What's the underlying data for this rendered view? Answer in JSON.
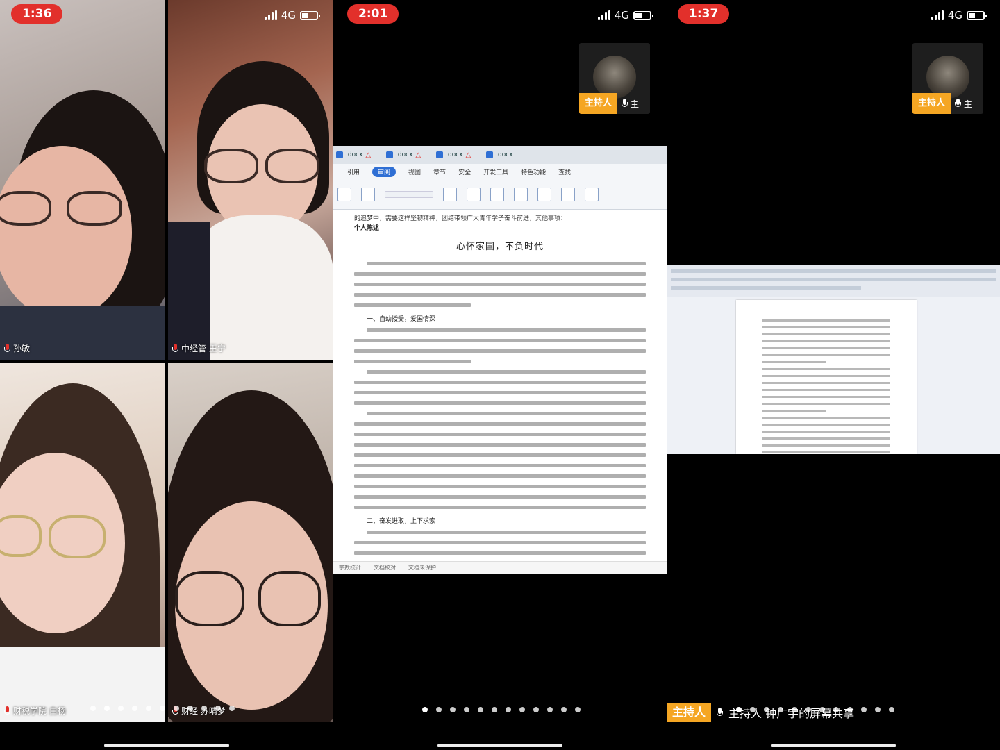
{
  "panel1": {
    "time": "1:36",
    "network": "4G",
    "tiles": [
      {
        "name": "孙敏"
      },
      {
        "name": "中经管 王宁"
      },
      {
        "name": "财税学院 白杨"
      },
      {
        "name": "财经 苏晴梦"
      }
    ],
    "page_dots": 11,
    "active_dot": 1
  },
  "panel2": {
    "time": "2:01",
    "network": "4G",
    "host": {
      "badge": "主持人",
      "mic_label": "主"
    },
    "doc": {
      "tabs": [
        ".docx",
        ".docx",
        ".docx",
        ".docx"
      ],
      "menu": [
        "引用",
        "审阅",
        "视图",
        "章节",
        "安全",
        "开发工具",
        "特色功能",
        "查找"
      ],
      "menu_selected": "审阅",
      "pre_line": "的追梦中，需要这样坚韧精神，团结带领广大青年学子奋斗前进，其他事项：",
      "section_label": "个人陈述",
      "title": "心怀家国，不负时代",
      "heading1": "一、自幼授受，爱国情深",
      "heading2": "二、奋发进取，上下求索",
      "footer": [
        "字数统计",
        "文档校对",
        "文档未保护"
      ]
    },
    "page_dots": 12
  },
  "panel3": {
    "time": "1:37",
    "network": "4G",
    "host": {
      "badge": "主持人",
      "mic_label": "主"
    },
    "caption": {
      "badge": "主持人",
      "text": "主持人 钟广宇的屏幕共享"
    },
    "page_dots": 12
  }
}
